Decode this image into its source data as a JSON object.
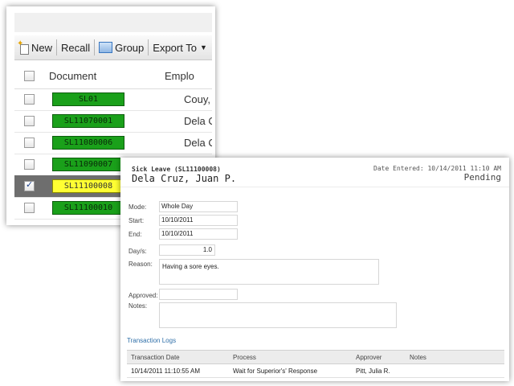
{
  "toolbar": {
    "new_label": "New",
    "recall_label": "Recall",
    "group_label": "Group",
    "export_label": "Export To"
  },
  "list": {
    "columns": {
      "document": "Document",
      "employee": "Emplo"
    },
    "rows": [
      {
        "doc": "SL01",
        "employee": "Couy,",
        "color": "green",
        "checked": false
      },
      {
        "doc": "SL11070001",
        "employee": "Dela C",
        "color": "green",
        "checked": false
      },
      {
        "doc": "SL11080006",
        "employee": "Dela C",
        "color": "green",
        "checked": false
      },
      {
        "doc": "SL11090007",
        "employee": "",
        "color": "green",
        "checked": false
      },
      {
        "doc": "SL11100008",
        "employee": "",
        "color": "yellow",
        "checked": true
      },
      {
        "doc": "SL11100010",
        "employee": "",
        "color": "green",
        "checked": false
      }
    ]
  },
  "detail": {
    "subtitle": "Sick Leave  (SL11100008)",
    "name": "Dela Cruz, Juan P.",
    "date_entered": "Date Entered: 10/14/2011 11:10 AM",
    "status": "Pending",
    "labels": {
      "mode": "Mode:",
      "start": "Start:",
      "end": "End:",
      "days": "Day/s:",
      "reason": "Reason:",
      "approved": "Approved:",
      "notes": "Notes:"
    },
    "values": {
      "mode": "Whole Day",
      "start": "10/10/2011",
      "end": "10/10/2011",
      "days": "1.0",
      "reason": "Having a sore eyes.",
      "approved": "",
      "notes": ""
    },
    "logs_link": "Transaction Logs",
    "log_columns": {
      "date": "Transaction Date",
      "process": "Process",
      "approver": "Approver",
      "notes": "Notes"
    },
    "log_rows": [
      {
        "date": "10/14/2011 11:10:55 AM",
        "process": "Wait for Superior's' Response",
        "approver": "Pitt, Julia R.",
        "notes": ""
      }
    ]
  },
  "colors": {
    "chip_green": "#1aa01a",
    "chip_yellow": "#ffff33",
    "selected_row": "#6e6e6e",
    "link": "#2f6fa8"
  }
}
